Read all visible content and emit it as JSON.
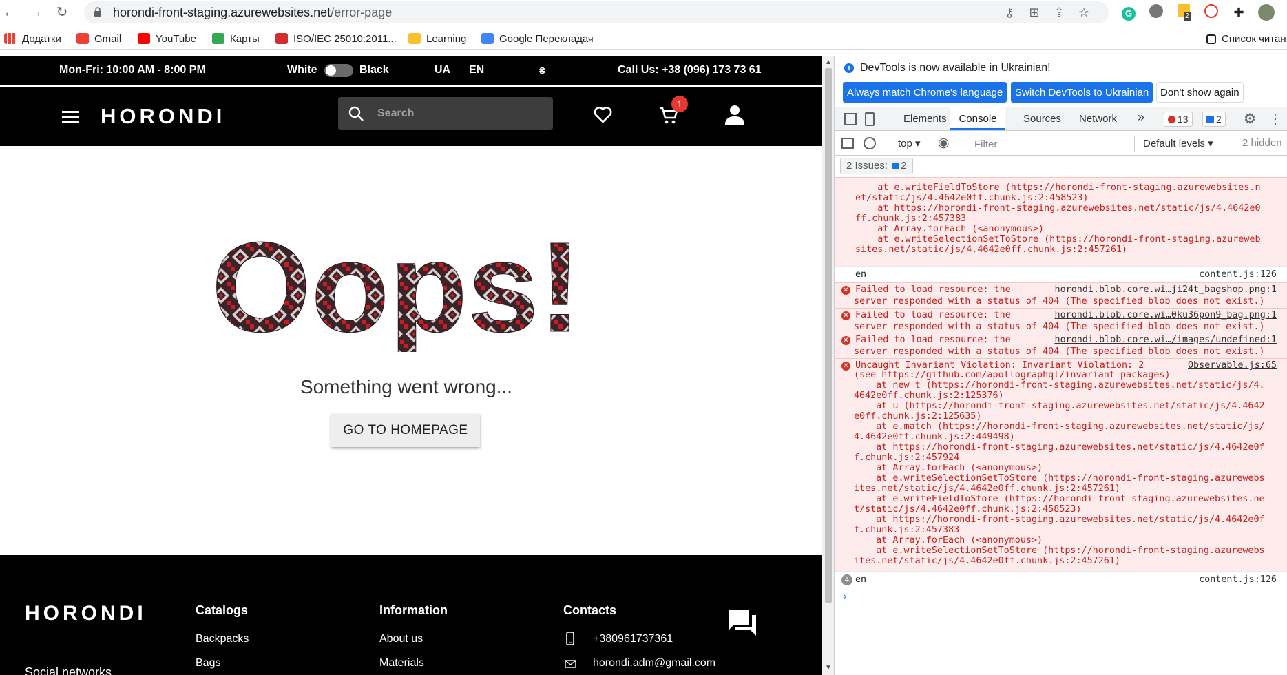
{
  "browser": {
    "url_host": "horondi-front-staging.azurewebsites.net",
    "url_path": "/error-page",
    "bookmarks": [
      {
        "label": "Додатки",
        "icon": "apps-grid-icon",
        "color": "#4285f4"
      },
      {
        "label": "Gmail",
        "icon": "gmail-icon",
        "color": "#ea4335"
      },
      {
        "label": "YouTube",
        "icon": "youtube-icon",
        "color": "#ff0000"
      },
      {
        "label": "Карты",
        "icon": "maps-icon",
        "color": "#34a853"
      },
      {
        "label": "ISO/IEC 25010:2011...",
        "icon": "iso-icon",
        "color": "#d32f2f"
      },
      {
        "label": "Learning",
        "icon": "folder-icon",
        "color": "#fbc02d"
      },
      {
        "label": "Google Перекладач",
        "icon": "translate-icon",
        "color": "#4285f4"
      }
    ],
    "reading_list": "Список читан",
    "extension_badge": "2"
  },
  "site": {
    "topbar": {
      "hours": "Mon-Fri: 10:00 AM - 8:00 PM",
      "theme_white": "White",
      "theme_black": "Black",
      "lang_ua": "UA",
      "lang_en": "EN",
      "currency": "₴",
      "phone": "Call Us: +38 (096) 173 73 61"
    },
    "logo": "HORONDI",
    "search_placeholder": "Search",
    "cart_count": "1",
    "oops": "Oops!",
    "message": "Something went wrong...",
    "home_button": "GO TO HOMEPAGE",
    "footer": {
      "logo": "HORONDI",
      "social": "Social networks",
      "catalogs": {
        "title": "Catalogs",
        "items": [
          "Backpacks",
          "Bags"
        ]
      },
      "information": {
        "title": "Information",
        "items": [
          "About us",
          "Materials"
        ]
      },
      "contacts": {
        "title": "Contacts",
        "phone": "+380961737361",
        "email": "horondi.adm@gmail.com"
      }
    }
  },
  "devtools": {
    "info": "DevTools is now available in Ukrainian!",
    "btn_match": "Always match Chrome's language",
    "btn_switch": "Switch DevTools to Ukrainian",
    "btn_dont": "Don't show again",
    "tabs": [
      "Elements",
      "Console",
      "Sources",
      "Network"
    ],
    "more": "»",
    "error_count": "13",
    "msg_count": "2",
    "context": "top",
    "filter_placeholder": "Filter",
    "levels": "Default levels",
    "hidden": "2 hidden",
    "issues_label": "2 Issues:",
    "issues_count": "2",
    "log": {
      "first_lines": [
        "    at e.writeFieldToStore (https://horondi-front-staging.azurewebsites.n",
        "et/static/js/4.4642e0ff.chunk.js:2:458523)",
        "    at https://horondi-front-staging.azurewebsites.net/static/js/4.4642e0",
        "ff.chunk.js:2:457383",
        "    at Array.forEach (<anonymous>)",
        "    at e.writeSelectionSetToStore (https://horondi-front-staging.azureweb",
        "sites.net/static/js/4.4642e0ff.chunk.js:2:457261)"
      ],
      "en1": "en",
      "en1_src": "content.js:126",
      "fails": [
        {
          "text1": "Failed to load resource: the",
          "src": "horondi.blob.core.wi…ji24t_bagshop.png:1",
          "text2": "server responded with a status of 404 (The specified blob does not exist.)"
        },
        {
          "text1": "Failed to load resource: the",
          "src": "horondi.blob.core.wi…0ku36pon9_bag.png:1",
          "text2": "server responded with a status of 404 (The specified blob does not exist.)"
        },
        {
          "text1": "Failed to load resource: the",
          "src": "horondi.blob.core.wi…/images/undefined:1",
          "text2": "server responded with a status of 404 (The specified blob does not exist.)"
        }
      ],
      "invariant_head": "Uncaught Invariant Violation: Invariant Violation: 2",
      "invariant_src": "Observable.js:65",
      "invariant_lines": [
        "(see https://github.com/apollographql/invariant-packages)",
        "    at new t (https://horondi-front-staging.azurewebsites.net/static/js/4.",
        "4642e0ff.chunk.js:2:125376)",
        "    at u (https://horondi-front-staging.azurewebsites.net/static/js/4.4642",
        "e0ff.chunk.js:2:125635)",
        "    at e.match (https://horondi-front-staging.azurewebsites.net/static/js/",
        "4.4642e0ff.chunk.js:2:449498)",
        "    at https://horondi-front-staging.azurewebsites.net/static/js/4.4642e0f",
        "f.chunk.js:2:457924",
        "    at Array.forEach (<anonymous>)",
        "    at e.writeSelectionSetToStore (https://horondi-front-staging.azurewebs",
        "ites.net/static/js/4.4642e0ff.chunk.js:2:457261)",
        "    at e.writeFieldToStore (https://horondi-front-staging.azurewebsites.ne",
        "t/static/js/4.4642e0ff.chunk.js:2:458523)",
        "    at https://horondi-front-staging.azurewebsites.net/static/js/4.4642e0f",
        "f.chunk.js:2:457383",
        "    at Array.forEach (<anonymous>)",
        "    at e.writeSelectionSetToStore (https://horondi-front-staging.azurewebs",
        "ites.net/static/js/4.4642e0ff.chunk.js:2:457261)"
      ],
      "en2_repeat": "4",
      "en2": "en",
      "en2_src": "content.js:126",
      "prompt": "›"
    }
  },
  "colors": {
    "error_bg": "#fdeceb",
    "error_text": "#c5221f",
    "accent": "#1a73e8",
    "badge_red": "#e53935"
  }
}
